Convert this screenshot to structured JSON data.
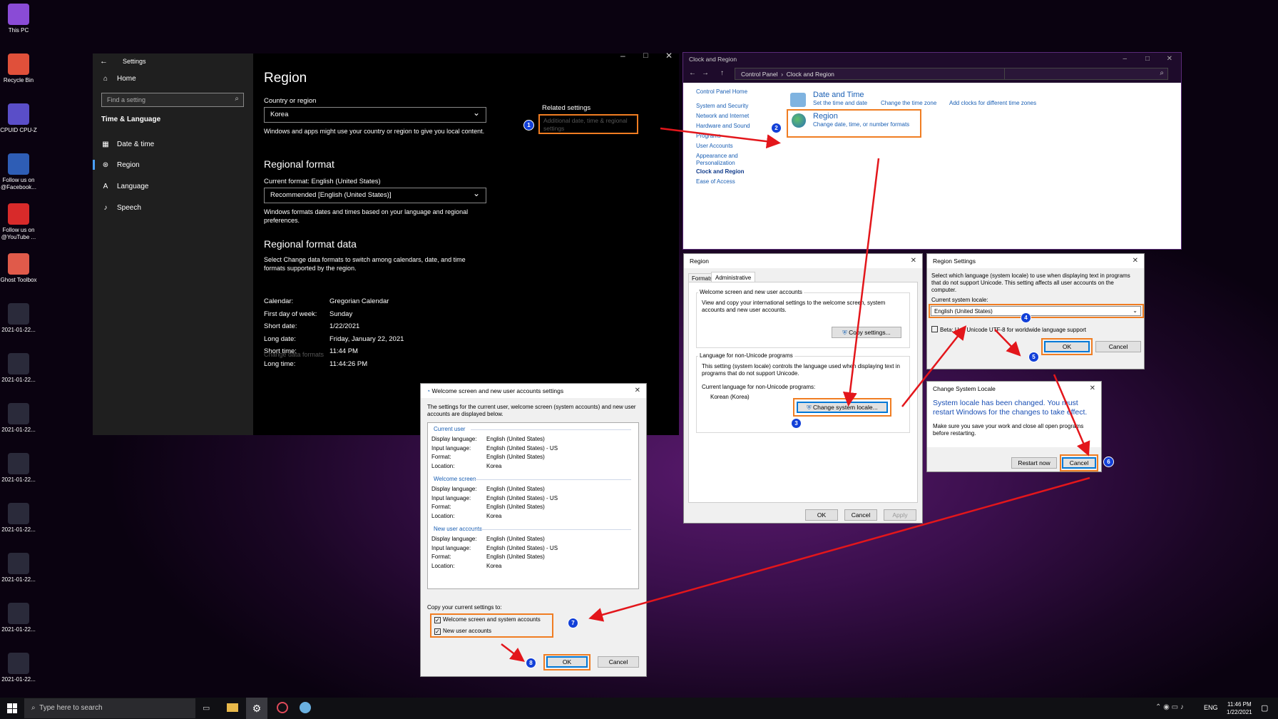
{
  "desktop": {
    "icons": [
      {
        "label": "This PC",
        "color": "#8a4bd6"
      },
      {
        "label": "Recycle Bin",
        "color": "#e0503a"
      },
      {
        "label": "CPUID CPU-Z",
        "color": "#5a4ec8"
      },
      {
        "label": "Follow us on @Facebook...",
        "color": "#2e5db5"
      },
      {
        "label": "Follow us on @YouTube ...",
        "color": "#d82a2a"
      },
      {
        "label": "Ghost Toolbox",
        "color": "#e05a4a"
      },
      {
        "label": "2021-01-22...",
        "color": "#2a2a3a"
      },
      {
        "label": "2021-01-22...",
        "color": "#2a2a3a"
      },
      {
        "label": "2021-01-22...",
        "color": "#2a2a3a"
      },
      {
        "label": "2021-01-22...",
        "color": "#2a2a3a"
      },
      {
        "label": "2021-01-22...",
        "color": "#2a2a3a"
      },
      {
        "label": "2021-01-22...",
        "color": "#2a2a3a"
      },
      {
        "label": "2021-01-22...",
        "color": "#2a2a3a"
      },
      {
        "label": "2021-01-22...",
        "color": "#2a2a3a"
      }
    ]
  },
  "settings": {
    "title": "Settings",
    "home": "Home",
    "search_placeholder": "Find a setting",
    "section": "Time & Language",
    "nav": [
      "Date & time",
      "Region",
      "Language",
      "Speech"
    ],
    "heading": "Region",
    "country_label": "Country or region",
    "country_value": "Korea",
    "country_desc": "Windows and apps might use your country or region to give you local content.",
    "regional_format_heading": "Regional format",
    "current_format": "Current format: English (United States)",
    "format_value": "Recommended [English (United States)]",
    "format_desc": "Windows formats dates and times based on your language and regional preferences.",
    "format_data_heading": "Regional format data",
    "format_data_desc": "Select Change data formats to switch among calendars, date, and time formats supported by the region.",
    "data": [
      {
        "k": "Calendar:",
        "v": "Gregorian Calendar"
      },
      {
        "k": "First day of week:",
        "v": "Sunday"
      },
      {
        "k": "Short date:",
        "v": "1/22/2021"
      },
      {
        "k": "Long date:",
        "v": "Friday, January 22, 2021"
      },
      {
        "k": "Short time:",
        "v": "11:44 PM"
      },
      {
        "k": "Long time:",
        "v": "11:44:26 PM"
      }
    ],
    "change_formats": "Change data formats",
    "related_title": "Related settings",
    "related_link": "Additional date, time & regional settings"
  },
  "control_panel": {
    "title": "Clock and Region",
    "crumbs": [
      "Control Panel",
      "Clock and Region"
    ],
    "left": [
      "Control Panel Home",
      "System and Security",
      "Network and Internet",
      "Hardware and Sound",
      "Programs",
      "User Accounts",
      "Appearance and Personalization",
      "Clock and Region",
      "Ease of Access"
    ],
    "dt_title": "Date and Time",
    "dt_links": [
      "Set the time and date",
      "Change the time zone",
      "Add clocks for different time zones"
    ],
    "region_title": "Region",
    "region_link": "Change date, time, or number formats"
  },
  "region_dialog": {
    "title": "Region",
    "tabs": [
      "Formats",
      "Administrative"
    ],
    "welcome_group": "Welcome screen and new user accounts",
    "welcome_desc": "View and copy your international settings to the welcome screen, system accounts and new user accounts.",
    "copy_btn": "Copy settings...",
    "nonunicode_group": "Language for non-Unicode programs",
    "nonunicode_desc": "This setting (system locale) controls the language used when displaying text in programs that do not support Unicode.",
    "current_label": "Current language for non-Unicode programs:",
    "current_value": "Korean (Korea)",
    "change_btn": "Change system locale...",
    "ok": "OK",
    "cancel": "Cancel",
    "apply": "Apply"
  },
  "region_settings": {
    "title": "Region Settings",
    "desc": "Select which language (system locale) to use when displaying text in programs that do not support Unicode. This setting affects all user accounts on the computer.",
    "locale_label": "Current system locale:",
    "locale_value": "English (United States)",
    "beta": "Beta: Use Unicode UTF-8 for worldwide language support",
    "ok": "OK",
    "cancel": "Cancel"
  },
  "change_locale": {
    "title": "Change System Locale",
    "headline": "System locale has been changed. You must restart Windows for the changes to take effect.",
    "body": "Make sure you save your work and close all open programs before restarting.",
    "restart": "Restart now",
    "cancel": "Cancel"
  },
  "welcome_dialog": {
    "title": "Welcome screen and new user accounts settings",
    "intro": "The settings for the current user, welcome screen (system accounts) and new user accounts are displayed below.",
    "sections": [
      {
        "name": "Current user",
        "rows": [
          [
            "Display language:",
            "English (United States)"
          ],
          [
            "Input language:",
            "English (United States) - US"
          ],
          [
            "Format:",
            "English (United States)"
          ],
          [
            "Location:",
            "Korea"
          ]
        ]
      },
      {
        "name": "Welcome screen",
        "rows": [
          [
            "Display language:",
            "English (United States)"
          ],
          [
            "Input language:",
            "English (United States) - US"
          ],
          [
            "Format:",
            "English (United States)"
          ],
          [
            "Location:",
            "Korea"
          ]
        ]
      },
      {
        "name": "New user accounts",
        "rows": [
          [
            "Display language:",
            "English (United States)"
          ],
          [
            "Input language:",
            "English (United States) - US"
          ],
          [
            "Format:",
            "English (United States)"
          ],
          [
            "Location:",
            "Korea"
          ]
        ]
      }
    ],
    "copy_label": "Copy your current settings to:",
    "cb1": "Welcome screen and system accounts",
    "cb2": "New user accounts",
    "ok": "OK",
    "cancel": "Cancel"
  },
  "steps": [
    "1",
    "2",
    "3",
    "4",
    "5",
    "6",
    "7",
    "8"
  ],
  "taskbar": {
    "search": "Type here to search",
    "lang": "ENG",
    "time": "11:46 PM",
    "date": "1/22/2021"
  },
  "colors": {
    "highlight": "#f07d22",
    "step": "#1240d8",
    "arrow": "#e3161b",
    "accent": "#0078d7"
  }
}
